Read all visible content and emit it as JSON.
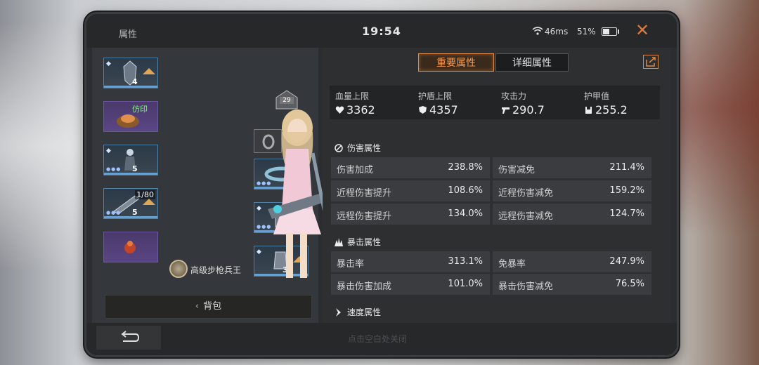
{
  "window": {
    "title": "属性",
    "clock": "19:54",
    "ping": "46ms",
    "battery": "51%",
    "battery_level": 0.51
  },
  "left_panel": {
    "slots": [
      {
        "icon": "gear-armor-icon",
        "level": "4"
      },
      {
        "icon": "wings-imprint-icon",
        "tag": "仿印"
      },
      {
        "icon": "gear-armor-icon",
        "level": "5"
      },
      {
        "icon": "gear-weapon-icon",
        "level": "5",
        "counter": "1/80"
      },
      {
        "icon": "pet-icon"
      },
      {
        "icon": "ring-icon"
      },
      {
        "icon": "bracelet-icon"
      },
      {
        "icon": "gear-armor-icon",
        "level": "5"
      },
      {
        "icon": "gear-armor-icon",
        "level": "3"
      }
    ],
    "badge_number": "29",
    "rank_name": "高级步枪兵王",
    "bag_label": "背包"
  },
  "right_panel": {
    "tabs": [
      {
        "label": "重要属性",
        "active": true
      },
      {
        "label": "详细属性",
        "active": false
      }
    ],
    "summary": [
      {
        "label": "血量上限",
        "value": "3362",
        "icon": "heart-icon"
      },
      {
        "label": "护盾上限",
        "value": "4357",
        "icon": "shield-icon"
      },
      {
        "label": "攻击力",
        "value": "290.7",
        "icon": "gun-icon"
      },
      {
        "label": "护甲值",
        "value": "255.2",
        "icon": "armor-icon"
      }
    ],
    "damage_section": {
      "title": "伤害属性",
      "rows": [
        {
          "left_label": "伤害加成",
          "left_value": "238.8%",
          "right_label": "伤害减免",
          "right_value": "211.4%"
        },
        {
          "left_label": "近程伤害提升",
          "left_value": "108.6%",
          "right_label": "近程伤害减免",
          "right_value": "159.2%"
        },
        {
          "left_label": "远程伤害提升",
          "left_value": "134.0%",
          "right_label": "远程伤害减免",
          "right_value": "124.7%"
        }
      ]
    },
    "crit_section": {
      "title": "暴击属性",
      "rows": [
        {
          "left_label": "暴击率",
          "left_value": "313.1%",
          "right_label": "免暴率",
          "right_value": "247.9%"
        },
        {
          "left_label": "暴击伤害加成",
          "left_value": "101.0%",
          "right_label": "暴击伤害减免",
          "right_value": "76.5%"
        }
      ]
    },
    "speed_section": {
      "title": "速度属性"
    }
  },
  "bottom": {
    "hint": "点击空白处关闭"
  },
  "colors": {
    "accent": "#e08a40",
    "panel": "#2d2f31",
    "row": "#3a3c3f"
  }
}
